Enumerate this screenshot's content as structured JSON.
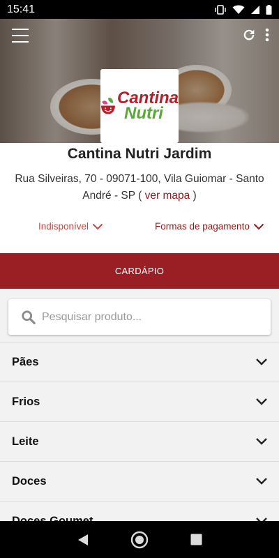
{
  "status_bar": {
    "time": "15:41"
  },
  "header": {
    "menu_icon": "hamburger-icon",
    "refresh_icon": "refresh-icon",
    "more_icon": "more-vert-icon"
  },
  "logo": {
    "line1": "Cantina",
    "line2": "Nutri"
  },
  "store": {
    "name": "Cantina Nutri Jardim",
    "address": "Rua Silveiras, 70 - 09071-100, Vila Guiomar - Santo André - SP (",
    "map_link": "ver mapa",
    "address_end": ")",
    "status": "Indisponível",
    "payment": "Formas de pagamento"
  },
  "tabs": [
    {
      "label": "CARDÁPIO"
    }
  ],
  "search": {
    "placeholder": "Pesquisar produto..."
  },
  "categories": [
    {
      "label": "Pães"
    },
    {
      "label": "Frios"
    },
    {
      "label": "Leite"
    },
    {
      "label": "Doces"
    },
    {
      "label": "Doces Goumet"
    }
  ],
  "colors": {
    "brand_red": "#9a1f25",
    "link_red": "#8b1a1a",
    "logo_red": "#c0494b",
    "logo_green": "#5aa83a"
  }
}
